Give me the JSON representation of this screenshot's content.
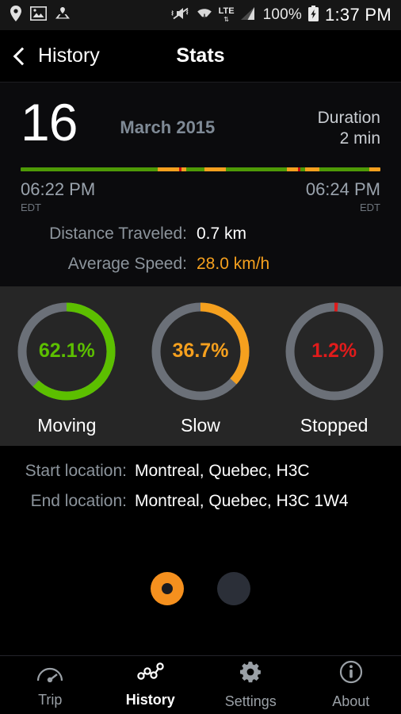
{
  "statusbar": {
    "left_icons": [
      "location-pin-icon",
      "image-icon",
      "map-pin-icon"
    ],
    "right_icons": [
      "vibrate-mute-icon",
      "wifi-icon",
      "lte-icon",
      "signal-bars-icon",
      "battery-charging-icon"
    ],
    "lte_label": "LTE",
    "battery_percent": "100%",
    "clock": "1:37 PM"
  },
  "header": {
    "back_label": "History",
    "title": "Stats"
  },
  "summary": {
    "day": "16",
    "month_year": "March 2015",
    "duration_label": "Duration",
    "duration_value": "2 min",
    "start_time": "06:22 PM",
    "start_zone": "EDT",
    "end_time": "06:24 PM",
    "end_zone": "EDT",
    "distance_label": "Distance Traveled:",
    "distance_value": "0.7 km",
    "speed_label": "Average Speed:",
    "speed_value": "28.0 km/h"
  },
  "timeline": {
    "segments": [
      {
        "color": "#4E9A06",
        "width": 38.0
      },
      {
        "color": "#F5A01E",
        "width": 6.0
      },
      {
        "color": "#CC1111",
        "width": 0.7
      },
      {
        "color": "#F5A01E",
        "width": 1.3
      },
      {
        "color": "#4E9A06",
        "width": 5.0
      },
      {
        "color": "#F5A01E",
        "width": 6.0
      },
      {
        "color": "#4E9A06",
        "width": 17.0
      },
      {
        "color": "#F5A01E",
        "width": 3.0
      },
      {
        "color": "#CC1111",
        "width": 0.8
      },
      {
        "color": "#4E9A06",
        "width": 1.2
      },
      {
        "color": "#F5A01E",
        "width": 4.0
      },
      {
        "color": "#4E9A06",
        "width": 14.0
      },
      {
        "color": "#F5A01E",
        "width": 3.0
      }
    ]
  },
  "chart_data": {
    "type": "pie",
    "title": "Trip time distribution",
    "categories": [
      "Moving",
      "Slow",
      "Stopped"
    ],
    "values": [
      62.1,
      36.7,
      1.2
    ],
    "labels": [
      "62.1%",
      "36.7%",
      "1.2%"
    ],
    "colors": [
      "#5CBF00",
      "#F5A01E",
      "#E01B1B"
    ],
    "track_color": "#6B7078",
    "unit": "%",
    "ylim": [
      0,
      100
    ]
  },
  "locations": {
    "start_label": "Start location:",
    "start_value": "Montreal, Quebec, H3C",
    "end_label": "End location:",
    "end_value": "Montreal, Quebec, H3C 1W4"
  },
  "pager": {
    "active_index": 0,
    "count": 2,
    "active_color": "#F5901E",
    "idle_color": "#2b2f38"
  },
  "navbar": {
    "items": [
      {
        "label": "Trip",
        "icon": "speedometer-icon",
        "active": false
      },
      {
        "label": "History",
        "icon": "node-graph-icon",
        "active": true
      },
      {
        "label": "Settings",
        "icon": "gear-icon",
        "active": false
      },
      {
        "label": "About",
        "icon": "info-circle-icon",
        "active": false
      }
    ]
  }
}
